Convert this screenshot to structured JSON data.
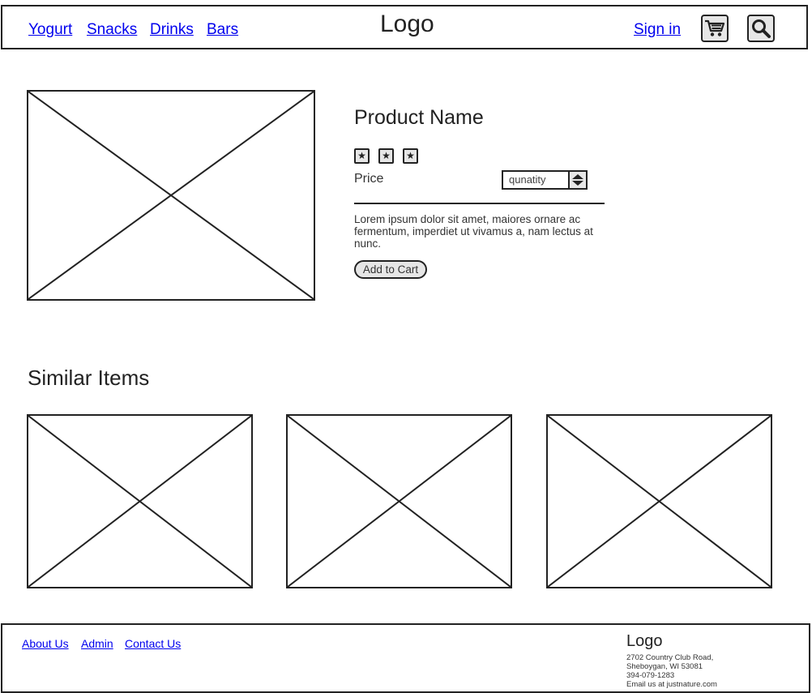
{
  "header": {
    "nav": [
      "Yogurt",
      "Snacks",
      "Drinks",
      "Bars"
    ],
    "logo": "Logo",
    "sign_in": "Sign in",
    "icons": [
      "cart-icon",
      "search-icon"
    ]
  },
  "product": {
    "name": "Product Name",
    "rating": 3,
    "star_glyph": "★",
    "price_label": "Price",
    "quantity_placeholder": "qunatity",
    "description": "Lorem ipsum dolor sit amet, maiores ornare ac fermentum, imperdiet ut vivamus a, nam lectus at nunc.",
    "add_to_cart": "Add to Cart"
  },
  "similar": {
    "title": "Similar Items",
    "count": 3
  },
  "footer": {
    "links": [
      "About Us",
      "Admin",
      "Contact Us"
    ],
    "logo": "Logo",
    "address_line1": "2702 Country Club Road,",
    "address_line2": "Sheboygan, WI 53081",
    "phone": "394-079-1283",
    "email": "Email us at justnature.com"
  },
  "colors": {
    "border": "#222222",
    "link": "#0000ee",
    "button_fill": "#e6e6e6"
  }
}
